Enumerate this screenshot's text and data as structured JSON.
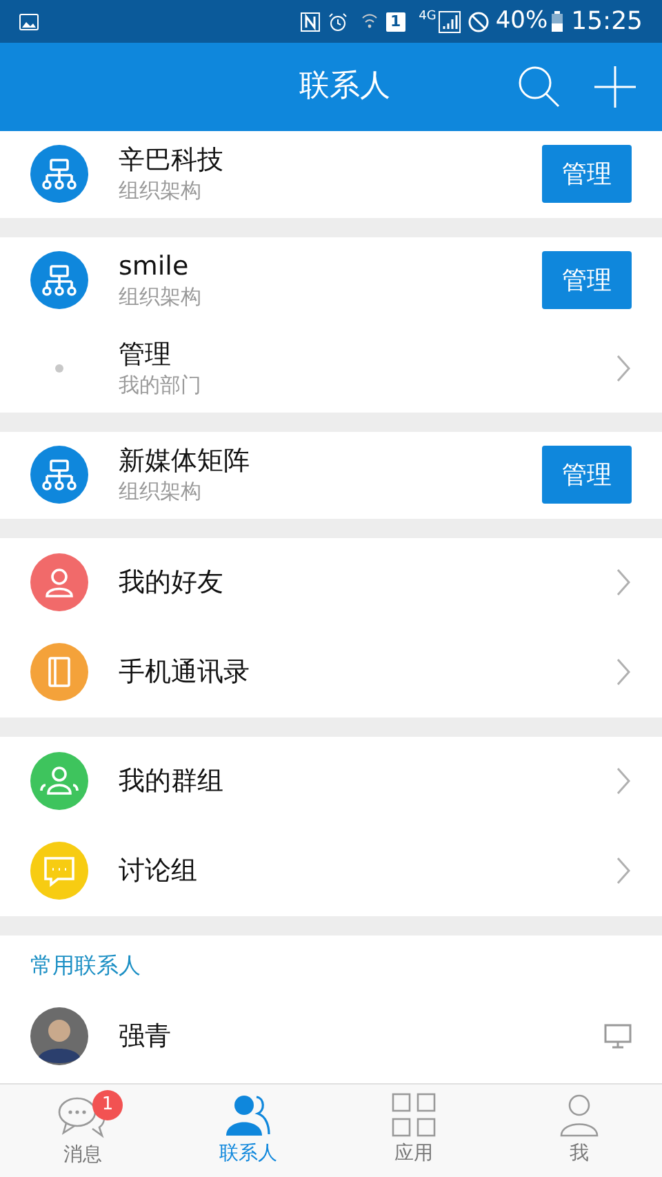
{
  "status_bar": {
    "sim": "1",
    "network": "4G",
    "battery": "40%",
    "time": "15:25"
  },
  "header": {
    "title": "联系人"
  },
  "sections": [
    {
      "items": [
        {
          "kind": "org",
          "title": "辛巴科技",
          "subtitle": "组织架构",
          "action": "管理"
        }
      ]
    },
    {
      "items": [
        {
          "kind": "org",
          "title": "smile",
          "subtitle": "组织架构",
          "action": "管理"
        },
        {
          "kind": "dept",
          "title": "管理",
          "subtitle": "我的部门"
        }
      ]
    },
    {
      "items": [
        {
          "kind": "org",
          "title": "新媒体矩阵",
          "subtitle": "组织架构",
          "action": "管理"
        }
      ]
    },
    {
      "items": [
        {
          "kind": "entry",
          "title": "我的好友",
          "color": "#f16a6a"
        },
        {
          "kind": "entry",
          "title": "手机通讯录",
          "color": "#f4a23a"
        }
      ]
    },
    {
      "items": [
        {
          "kind": "entry",
          "title": "我的群组",
          "color": "#3ec45d"
        },
        {
          "kind": "entry",
          "title": "讨论组",
          "color": "#f7cc12"
        }
      ]
    }
  ],
  "frequent": {
    "label": "常用联系人",
    "contacts": [
      {
        "name": "强青"
      }
    ]
  },
  "tabs": [
    {
      "label": "消息",
      "selected": false,
      "badge": "1"
    },
    {
      "label": "联系人",
      "selected": true
    },
    {
      "label": "应用",
      "selected": false
    },
    {
      "label": "我",
      "selected": false
    }
  ]
}
